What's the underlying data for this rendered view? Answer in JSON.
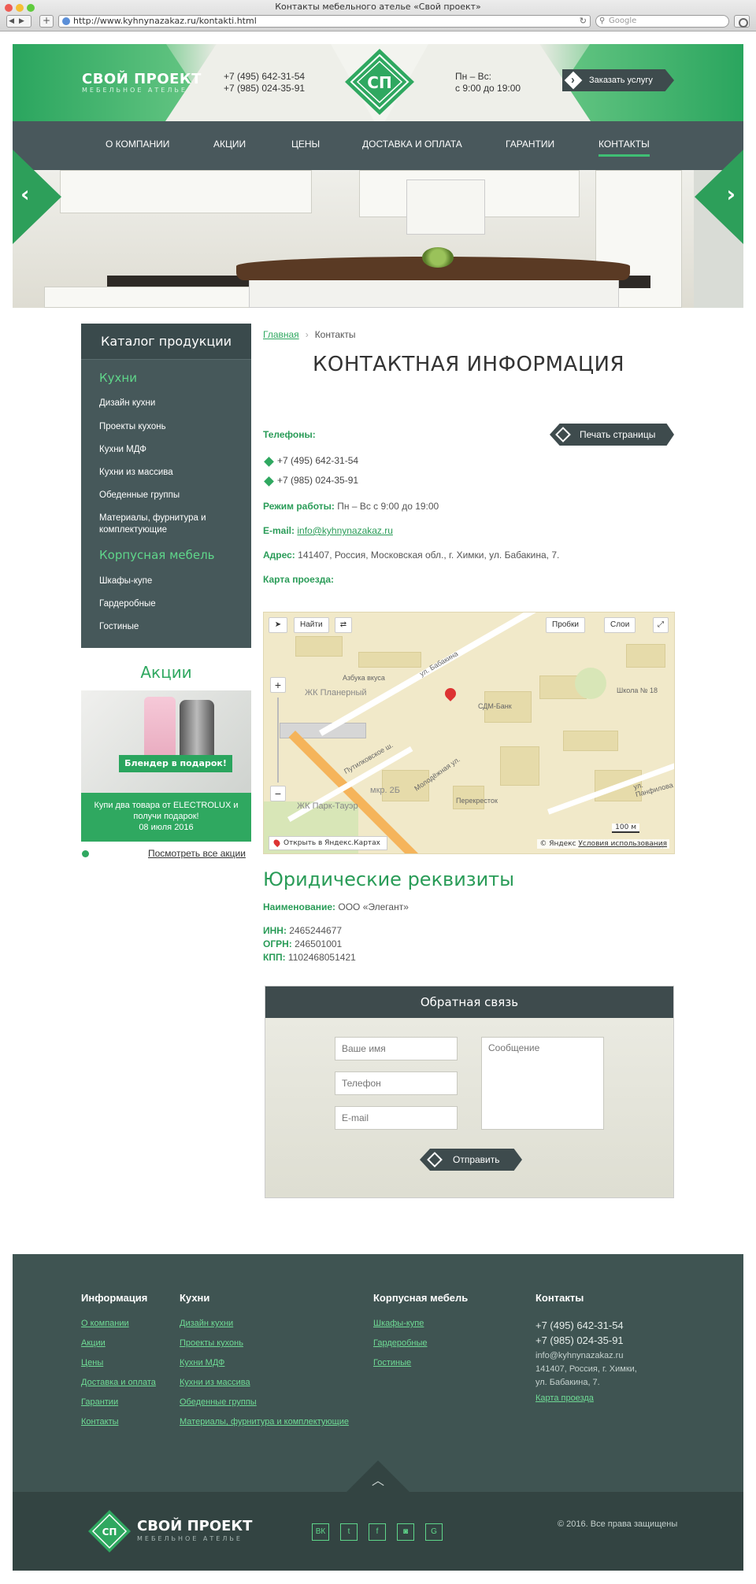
{
  "browser": {
    "window_title": "Контакты мебельного ателье «Свой проект»",
    "url": "http://www.kyhnynazakaz.ru/kontakti.html",
    "search_placeholder": "Google"
  },
  "header": {
    "logo_title": "СВОЙ ПРОЕКТ",
    "logo_subtitle": "МЕБЕЛЬНОЕ АТЕЛЬЕ",
    "emblem_text": "СП",
    "phone1": "+7 (495) 642-31-54",
    "phone2": "+7 (985) 024-35-91",
    "hours_label": "Пн – Вс:",
    "hours_value": "с 9:00 до 19:00",
    "order_button": "Заказать услугу"
  },
  "nav": {
    "items": [
      "О КОМПАНИИ",
      "АКЦИИ",
      "ЦЕНЫ",
      "ДОСТАВКА И ОПЛАТА",
      "ГАРАНТИИ",
      "КОНТАКТЫ"
    ],
    "active": "КОНТАКТЫ"
  },
  "sidebar": {
    "title": "Каталог продукции",
    "group1": "Кухни",
    "group1_items": [
      "Дизайн кухни",
      "Проекты кухонь",
      "Кухни МДФ",
      "Кухни из массива",
      "Обеденные группы",
      "Материалы, фурнитура и комплектующие"
    ],
    "group2": "Корпусная мебель",
    "group2_items": [
      "Шкафы-купе",
      "Гардеробные",
      "Гостиные"
    ]
  },
  "promo": {
    "title": "Акции",
    "badge": "Блендер в подарок!",
    "text": "Купи два товара от ELECTROLUX и получи подарок!",
    "date": "08 июля 2016",
    "all_link": "Посмотреть все акции"
  },
  "breadcrumb": {
    "home": "Главная",
    "current": "Контакты"
  },
  "contacts": {
    "title": "КОНТАКТНАЯ ИНФОРМАЦИЯ",
    "phones_label": "Телефоны:",
    "phones": [
      "+7 (495) 642-31-54",
      "+7 (985) 024-35-91"
    ],
    "print_button": "Печать страницы",
    "hours_label": "Режим работы:",
    "hours_value": "Пн – Вс с 9:00 до 19:00",
    "email_label": "E-mail:",
    "email_value": "info@kyhnynazakaz.ru",
    "address_label": "Адрес:",
    "address_value": "141407, Россия, Московская обл., г. Химки, ул. Бабакина, 7.",
    "map_label": "Карта проезда:"
  },
  "map": {
    "find_button": "Найти",
    "traffic_button": "Пробки",
    "layers_button": "Слои",
    "open_link": "Открыть в Яндекс.Картах",
    "copyright": "© Яндекс",
    "terms": "Условия использования",
    "scale": "100 м",
    "labels": [
      "Азбука вкуса",
      "ЖК Планерный",
      "СДМ-Банк",
      "Школа № 18",
      "Молодёжная ул.",
      "Путилковское ш.",
      "ул. Бабакина",
      "мкр. 2Б",
      "ЖК Парк-Тауэр",
      "Перекресток",
      "ул. Панфилова",
      "Мол"
    ]
  },
  "legal": {
    "title": "Юридические реквизиты",
    "name_label": "Наименование:",
    "name_value": "ООО «Элегант»",
    "inn_label": "ИНН:",
    "inn_value": "2465244677",
    "ogrn_label": "ОГРН:",
    "ogrn_value": "246501001",
    "kpp_label": "КПП:",
    "kpp_value": "1102468051421"
  },
  "feedback": {
    "title": "Обратная связь",
    "name_placeholder": "Ваше имя",
    "phone_placeholder": "Телефон",
    "email_placeholder": "E-mail",
    "message_placeholder": "Сообщение",
    "send_button": "Отправить"
  },
  "footer": {
    "col1_title": "Информация",
    "col1_links": [
      "О компании",
      "Акции",
      "Цены",
      "Доставка и оплата",
      "Гарантии",
      "Контакты"
    ],
    "col2_title": "Кухни",
    "col2_links": [
      "Дизайн кухни",
      "Проекты кухонь",
      "Кухни МДФ",
      "Кухни из массива",
      "Обеденные группы",
      "Материалы, фурнитура и комплектующие"
    ],
    "col3_title": "Корпусная мебель",
    "col3_links": [
      "Шкафы-купе",
      "Гардеробные",
      "Гостиные"
    ],
    "col4_title": "Контакты",
    "phone1": "+7 (495) 642-31-54",
    "phone2": "+7 (985) 024-35-91",
    "email": "info@kyhnynazakaz.ru",
    "address_line1": "141407, Россия, г. Химки,",
    "address_line2": "ул. Бабакина, 7.",
    "map_link": "Карта проезда",
    "logo_title": "СВОЙ ПРОЕКТ",
    "logo_subtitle": "МЕБЕЛЬНОЕ АТЕЛЬЕ",
    "social": [
      "ВК",
      "t",
      "f",
      "◙",
      "G"
    ],
    "copyright": "© 2016. Все права защищены"
  },
  "colors": {
    "brand_green": "#2fa860",
    "dark_slate": "#3e4b4d",
    "footer_bg": "#3f5452"
  }
}
